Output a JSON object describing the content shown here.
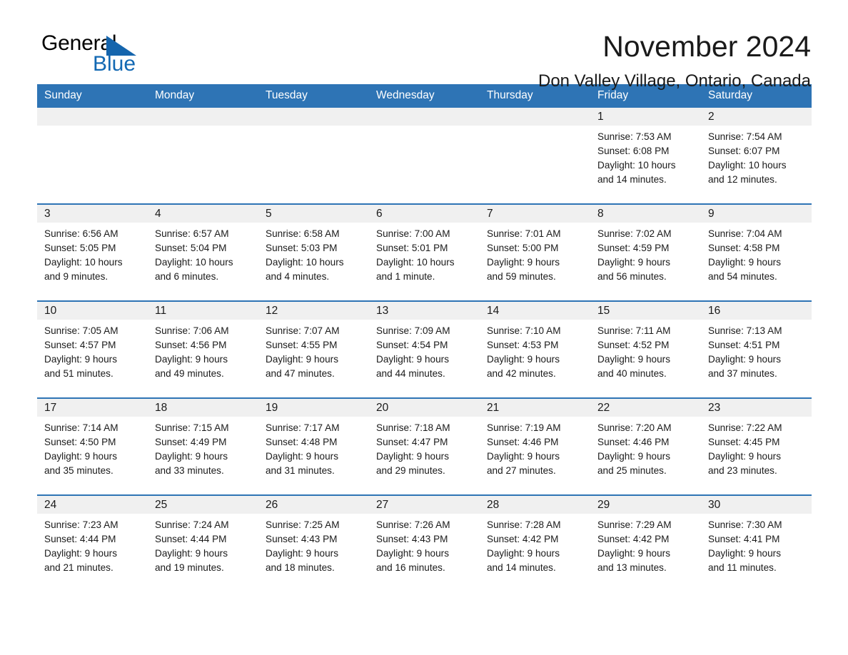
{
  "brand": {
    "name_part1": "General",
    "name_part2": "Blue",
    "triangle_color": "#1565ad",
    "blue_color": "#1268b3"
  },
  "header": {
    "title": "November 2024",
    "location": "Don Valley Village, Ontario, Canada"
  },
  "theme": {
    "header_bg": "#2e74b5",
    "daynum_bg": "#f0f0f0",
    "row_divider": "#2e74b5",
    "text": "#1a1a1a"
  },
  "weekdays": [
    "Sunday",
    "Monday",
    "Tuesday",
    "Wednesday",
    "Thursday",
    "Friday",
    "Saturday"
  ],
  "labels": {
    "sunrise_prefix": "Sunrise:",
    "sunset_prefix": "Sunset:",
    "daylight_prefix": "Daylight:"
  },
  "weeks": [
    [
      {
        "day": "",
        "lines": []
      },
      {
        "day": "",
        "lines": []
      },
      {
        "day": "",
        "lines": []
      },
      {
        "day": "",
        "lines": []
      },
      {
        "day": "",
        "lines": []
      },
      {
        "day": "1",
        "lines": [
          "Sunrise: 7:53 AM",
          "Sunset: 6:08 PM",
          "Daylight: 10 hours",
          "and 14 minutes."
        ]
      },
      {
        "day": "2",
        "lines": [
          "Sunrise: 7:54 AM",
          "Sunset: 6:07 PM",
          "Daylight: 10 hours",
          "and 12 minutes."
        ]
      }
    ],
    [
      {
        "day": "3",
        "lines": [
          "Sunrise: 6:56 AM",
          "Sunset: 5:05 PM",
          "Daylight: 10 hours",
          "and 9 minutes."
        ]
      },
      {
        "day": "4",
        "lines": [
          "Sunrise: 6:57 AM",
          "Sunset: 5:04 PM",
          "Daylight: 10 hours",
          "and 6 minutes."
        ]
      },
      {
        "day": "5",
        "lines": [
          "Sunrise: 6:58 AM",
          "Sunset: 5:03 PM",
          "Daylight: 10 hours",
          "and 4 minutes."
        ]
      },
      {
        "day": "6",
        "lines": [
          "Sunrise: 7:00 AM",
          "Sunset: 5:01 PM",
          "Daylight: 10 hours",
          "and 1 minute."
        ]
      },
      {
        "day": "7",
        "lines": [
          "Sunrise: 7:01 AM",
          "Sunset: 5:00 PM",
          "Daylight: 9 hours",
          "and 59 minutes."
        ]
      },
      {
        "day": "8",
        "lines": [
          "Sunrise: 7:02 AM",
          "Sunset: 4:59 PM",
          "Daylight: 9 hours",
          "and 56 minutes."
        ]
      },
      {
        "day": "9",
        "lines": [
          "Sunrise: 7:04 AM",
          "Sunset: 4:58 PM",
          "Daylight: 9 hours",
          "and 54 minutes."
        ]
      }
    ],
    [
      {
        "day": "10",
        "lines": [
          "Sunrise: 7:05 AM",
          "Sunset: 4:57 PM",
          "Daylight: 9 hours",
          "and 51 minutes."
        ]
      },
      {
        "day": "11",
        "lines": [
          "Sunrise: 7:06 AM",
          "Sunset: 4:56 PM",
          "Daylight: 9 hours",
          "and 49 minutes."
        ]
      },
      {
        "day": "12",
        "lines": [
          "Sunrise: 7:07 AM",
          "Sunset: 4:55 PM",
          "Daylight: 9 hours",
          "and 47 minutes."
        ]
      },
      {
        "day": "13",
        "lines": [
          "Sunrise: 7:09 AM",
          "Sunset: 4:54 PM",
          "Daylight: 9 hours",
          "and 44 minutes."
        ]
      },
      {
        "day": "14",
        "lines": [
          "Sunrise: 7:10 AM",
          "Sunset: 4:53 PM",
          "Daylight: 9 hours",
          "and 42 minutes."
        ]
      },
      {
        "day": "15",
        "lines": [
          "Sunrise: 7:11 AM",
          "Sunset: 4:52 PM",
          "Daylight: 9 hours",
          "and 40 minutes."
        ]
      },
      {
        "day": "16",
        "lines": [
          "Sunrise: 7:13 AM",
          "Sunset: 4:51 PM",
          "Daylight: 9 hours",
          "and 37 minutes."
        ]
      }
    ],
    [
      {
        "day": "17",
        "lines": [
          "Sunrise: 7:14 AM",
          "Sunset: 4:50 PM",
          "Daylight: 9 hours",
          "and 35 minutes."
        ]
      },
      {
        "day": "18",
        "lines": [
          "Sunrise: 7:15 AM",
          "Sunset: 4:49 PM",
          "Daylight: 9 hours",
          "and 33 minutes."
        ]
      },
      {
        "day": "19",
        "lines": [
          "Sunrise: 7:17 AM",
          "Sunset: 4:48 PM",
          "Daylight: 9 hours",
          "and 31 minutes."
        ]
      },
      {
        "day": "20",
        "lines": [
          "Sunrise: 7:18 AM",
          "Sunset: 4:47 PM",
          "Daylight: 9 hours",
          "and 29 minutes."
        ]
      },
      {
        "day": "21",
        "lines": [
          "Sunrise: 7:19 AM",
          "Sunset: 4:46 PM",
          "Daylight: 9 hours",
          "and 27 minutes."
        ]
      },
      {
        "day": "22",
        "lines": [
          "Sunrise: 7:20 AM",
          "Sunset: 4:46 PM",
          "Daylight: 9 hours",
          "and 25 minutes."
        ]
      },
      {
        "day": "23",
        "lines": [
          "Sunrise: 7:22 AM",
          "Sunset: 4:45 PM",
          "Daylight: 9 hours",
          "and 23 minutes."
        ]
      }
    ],
    [
      {
        "day": "24",
        "lines": [
          "Sunrise: 7:23 AM",
          "Sunset: 4:44 PM",
          "Daylight: 9 hours",
          "and 21 minutes."
        ]
      },
      {
        "day": "25",
        "lines": [
          "Sunrise: 7:24 AM",
          "Sunset: 4:44 PM",
          "Daylight: 9 hours",
          "and 19 minutes."
        ]
      },
      {
        "day": "26",
        "lines": [
          "Sunrise: 7:25 AM",
          "Sunset: 4:43 PM",
          "Daylight: 9 hours",
          "and 18 minutes."
        ]
      },
      {
        "day": "27",
        "lines": [
          "Sunrise: 7:26 AM",
          "Sunset: 4:43 PM",
          "Daylight: 9 hours",
          "and 16 minutes."
        ]
      },
      {
        "day": "28",
        "lines": [
          "Sunrise: 7:28 AM",
          "Sunset: 4:42 PM",
          "Daylight: 9 hours",
          "and 14 minutes."
        ]
      },
      {
        "day": "29",
        "lines": [
          "Sunrise: 7:29 AM",
          "Sunset: 4:42 PM",
          "Daylight: 9 hours",
          "and 13 minutes."
        ]
      },
      {
        "day": "30",
        "lines": [
          "Sunrise: 7:30 AM",
          "Sunset: 4:41 PM",
          "Daylight: 9 hours",
          "and 11 minutes."
        ]
      }
    ]
  ]
}
